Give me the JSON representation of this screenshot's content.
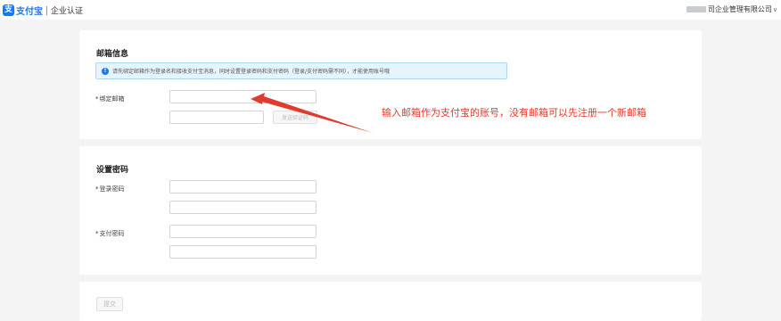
{
  "header": {
    "logo_mark": "支",
    "logo_text": "支付宝",
    "subtitle": "企业认证",
    "company": "司企业管理有限公司",
    "chevron": "∨"
  },
  "email_section": {
    "title": "邮箱信息",
    "notice": "请先绑定邮箱作为登录名和接收支付宝消息，同时设置登录密码和支付密码（登录/支付密码需不同），才能使用账号哦",
    "email_label": "绑定邮箱",
    "email_value": "",
    "code_value": "",
    "send_code_label": "发送验证码"
  },
  "password_section": {
    "title": "设置密码",
    "login_label": "登录密码",
    "pay_label": "支付密码"
  },
  "footer": {
    "submit_label": "提交"
  },
  "annotation": {
    "text": "输入邮箱作为支付宝的账号，没有邮箱可以先注册一个新邮箱",
    "color": "#e23b2e"
  },
  "colors": {
    "brand": "#1677ff",
    "notice_bg": "#e6f4fd"
  },
  "icons": {
    "info": "info-icon",
    "chevron": "chevron-down-icon",
    "arrow": "arrow-icon"
  }
}
